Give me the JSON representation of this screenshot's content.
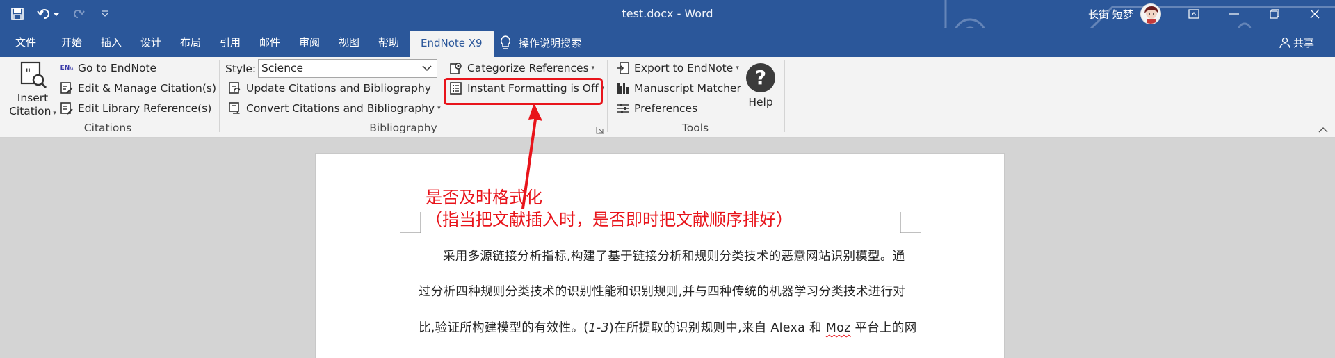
{
  "window": {
    "title": "test.docx - Word",
    "user_name": "长街 短梦"
  },
  "tabs": [
    {
      "label": "文件"
    },
    {
      "label": "开始"
    },
    {
      "label": "插入"
    },
    {
      "label": "设计"
    },
    {
      "label": "布局"
    },
    {
      "label": "引用"
    },
    {
      "label": "邮件"
    },
    {
      "label": "审阅"
    },
    {
      "label": "视图"
    },
    {
      "label": "帮助"
    },
    {
      "label": "EndNote X9"
    }
  ],
  "tell_me": "操作说明搜索",
  "share": "共享",
  "ribbon": {
    "citations": {
      "insert_line1": "Insert",
      "insert_line2": "Citation",
      "go_to_endnote": "Go to EndNote",
      "edit_manage": "Edit & Manage Citation(s)",
      "edit_library": "Edit Library Reference(s)",
      "group": "Citations"
    },
    "bibliography": {
      "style_label": "Style:",
      "style_value": "Science",
      "update": "Update Citations and Bibliography",
      "convert": "Convert Citations and Bibliography",
      "categorize": "Categorize References",
      "instant": "Instant Formatting is Off",
      "group": "Bibliography"
    },
    "tools": {
      "export": "Export to EndNote",
      "matcher": "Manuscript Matcher",
      "preferences": "Preferences",
      "help": "Help",
      "group": "Tools"
    }
  },
  "annotation": {
    "line1": "是否及时格式化",
    "line2": "（指当把文献插入时，是否即时把文献顺序排好）"
  },
  "document": {
    "line1": "采用多源链接分析指标,构建了基于链接分析和规则分类技术的恶意网站识别模型。通",
    "line2": "过分析四种规则分类技术的识别性能和识别规则,并与四种传统的机器学习分类技术进行对",
    "line3_a": "比,验证所构建模型的有效性。(",
    "line3_cite": "1-3",
    "line3_b": ")在所提取的识别规则中,来自 Alexa 和 ",
    "line3_moz": "Moz",
    "line3_c": " 平台上的网"
  },
  "colors": {
    "brand": "#2b579a",
    "ribbon_bg": "#f3f3f3",
    "annotation_red": "#e8141b"
  }
}
